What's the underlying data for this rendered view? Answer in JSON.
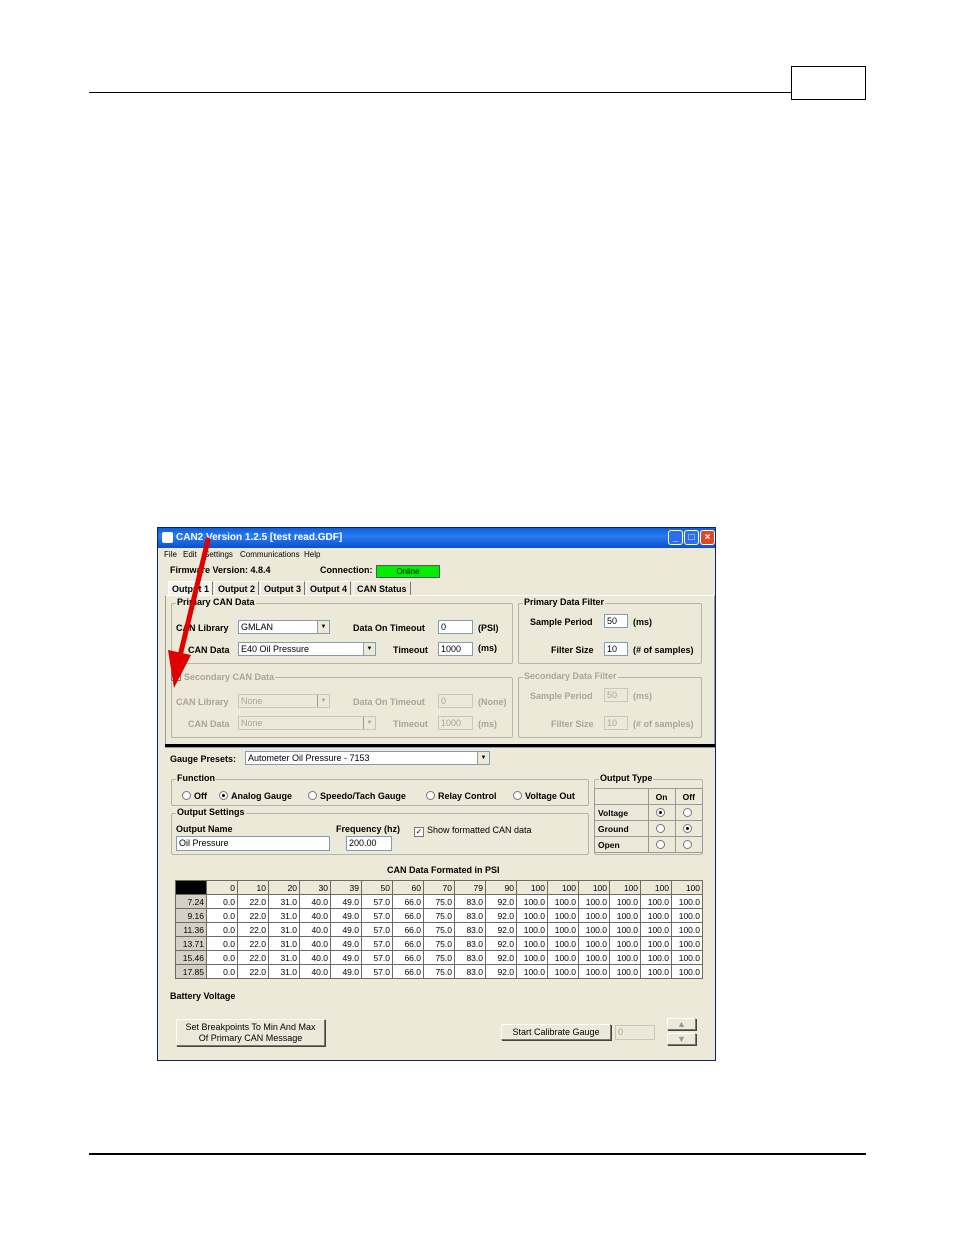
{
  "window": {
    "title": "CAN2 Version 1.2.5 [test read.GDF]",
    "menu": [
      "File",
      "Edit",
      "Settings",
      "Communications",
      "Help"
    ]
  },
  "status": {
    "firmware_label": "Firmware Version: 4.8.4",
    "connection_label": "Connection:",
    "connection_value": "Online"
  },
  "tabs": [
    "Output 1",
    "Output 2",
    "Output 3",
    "Output 4",
    "CAN Status"
  ],
  "primary_can": {
    "group_label": "Primary CAN Data",
    "library_label": "CAN Library",
    "library_value": "GMLAN",
    "data_label": "CAN Data",
    "data_value": "E40 Oil Pressure",
    "timeout_label": "Data On Timeout",
    "timeout_value": "0",
    "timeout_unit": "(PSI)",
    "timeout2_label": "Timeout",
    "timeout2_value": "1000",
    "timeout2_unit": "(ms)"
  },
  "primary_filter": {
    "group_label": "Primary Data Filter",
    "sample_label": "Sample Period",
    "sample_value": "50",
    "sample_unit": "(ms)",
    "filter_label": "Filter Size",
    "filter_value": "10",
    "filter_unit": "(# of samples)"
  },
  "secondary_can": {
    "group_label": "Secondary CAN Data",
    "library_label": "CAN Library",
    "library_value": "None",
    "data_label": "CAN Data",
    "data_value": "None",
    "timeout_label": "Data On Timeout",
    "timeout_value": "0",
    "timeout_unit": "(None)",
    "timeout2_label": "Timeout",
    "timeout2_value": "1000",
    "timeout2_unit": "(ms)"
  },
  "secondary_filter": {
    "group_label": "Secondary Data Filter",
    "sample_label": "Sample Period",
    "sample_value": "50",
    "sample_unit": "(ms)",
    "filter_label": "Filter Size",
    "filter_value": "10",
    "filter_unit": "(# of samples)"
  },
  "gauge": {
    "presets_label": "Gauge Presets:",
    "presets_value": "Autometer Oil Pressure - 7153"
  },
  "function": {
    "group_label": "Function",
    "options": [
      "Off",
      "Analog Gauge",
      "Speedo/Tach Gauge",
      "Relay Control",
      "Voltage Out"
    ],
    "selected": "Analog Gauge"
  },
  "output_settings": {
    "group_label": "Output Settings",
    "name_label": "Output Name",
    "name_value": "Oil Pressure",
    "freq_label": "Frequency (hz)",
    "freq_value": "200.00",
    "show_label": "Show formatted CAN data",
    "show_checked": "✓"
  },
  "output_type": {
    "group_label": "Output Type",
    "col_on": "On",
    "col_off": "Off",
    "rows": [
      "Voltage",
      "Ground",
      "Open"
    ],
    "selected": [
      "On",
      "Off",
      ""
    ]
  },
  "can_table": {
    "title": "CAN Data Formated in PSI",
    "columns": [
      "0",
      "10",
      "20",
      "30",
      "39",
      "50",
      "60",
      "70",
      "79",
      "90",
      "100",
      "100",
      "100",
      "100",
      "100",
      "100"
    ],
    "rows": [
      {
        "label": "7.24",
        "values": [
          "0.0",
          "22.0",
          "31.0",
          "40.0",
          "49.0",
          "57.0",
          "66.0",
          "75.0",
          "83.0",
          "92.0",
          "100.0",
          "100.0",
          "100.0",
          "100.0",
          "100.0",
          "100.0"
        ]
      },
      {
        "label": "9.16",
        "values": [
          "0.0",
          "22.0",
          "31.0",
          "40.0",
          "49.0",
          "57.0",
          "66.0",
          "75.0",
          "83.0",
          "92.0",
          "100.0",
          "100.0",
          "100.0",
          "100.0",
          "100.0",
          "100.0"
        ]
      },
      {
        "label": "11.36",
        "values": [
          "0.0",
          "22.0",
          "31.0",
          "40.0",
          "49.0",
          "57.0",
          "66.0",
          "75.0",
          "83.0",
          "92.0",
          "100.0",
          "100.0",
          "100.0",
          "100.0",
          "100.0",
          "100.0"
        ]
      },
      {
        "label": "13.71",
        "values": [
          "0.0",
          "22.0",
          "31.0",
          "40.0",
          "49.0",
          "57.0",
          "66.0",
          "75.0",
          "83.0",
          "92.0",
          "100.0",
          "100.0",
          "100.0",
          "100.0",
          "100.0",
          "100.0"
        ]
      },
      {
        "label": "15.46",
        "values": [
          "0.0",
          "22.0",
          "31.0",
          "40.0",
          "49.0",
          "57.0",
          "66.0",
          "75.0",
          "83.0",
          "92.0",
          "100.0",
          "100.0",
          "100.0",
          "100.0",
          "100.0",
          "100.0"
        ]
      },
      {
        "label": "17.85",
        "values": [
          "0.0",
          "22.0",
          "31.0",
          "40.0",
          "49.0",
          "57.0",
          "66.0",
          "75.0",
          "83.0",
          "92.0",
          "100.0",
          "100.0",
          "100.0",
          "100.0",
          "100.0",
          "100.0"
        ]
      }
    ],
    "row_axis_label": "Battery Voltage"
  },
  "bottom": {
    "breakpoints_line1": "Set Breakpoints To Min And Max",
    "breakpoints_line2": "Of Primary CAN Message",
    "calibrate_label": "Start Calibrate Gauge",
    "calibrate_value": "0"
  },
  "colors": {
    "online": "#00ee00",
    "annotation_arrow": "#e00000",
    "titlebar": "#0a5ee0"
  }
}
